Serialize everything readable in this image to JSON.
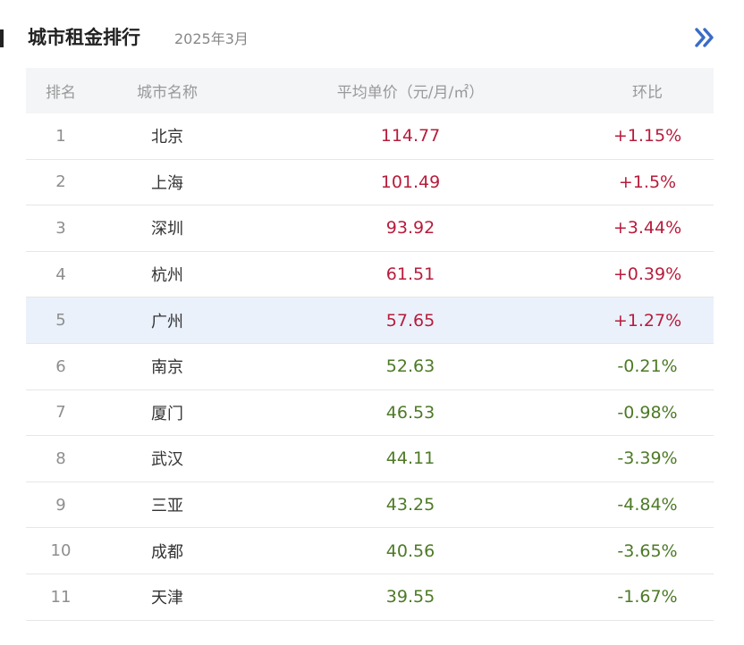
{
  "header": {
    "title": "城市租金排行",
    "date": "2025年3月"
  },
  "table": {
    "columns": [
      "排名",
      "城市名称",
      "平均单价（元/月/㎡）",
      "环比"
    ],
    "rows": [
      {
        "rank": "1",
        "city": "北京",
        "price": "114.77",
        "change": "+1.15%",
        "trend": "up"
      },
      {
        "rank": "2",
        "city": "上海",
        "price": "101.49",
        "change": "+1.5%",
        "trend": "up"
      },
      {
        "rank": "3",
        "city": "深圳",
        "price": "93.92",
        "change": "+3.44%",
        "trend": "up"
      },
      {
        "rank": "4",
        "city": "杭州",
        "price": "61.51",
        "change": "+0.39%",
        "trend": "up"
      },
      {
        "rank": "5",
        "city": "广州",
        "price": "57.65",
        "change": "+1.27%",
        "trend": "up"
      },
      {
        "rank": "6",
        "city": "南京",
        "price": "52.63",
        "change": "-0.21%",
        "trend": "down"
      },
      {
        "rank": "7",
        "city": "厦门",
        "price": "46.53",
        "change": "-0.98%",
        "trend": "down"
      },
      {
        "rank": "8",
        "city": "武汉",
        "price": "44.11",
        "change": "-3.39%",
        "trend": "down"
      },
      {
        "rank": "9",
        "city": "三亚",
        "price": "43.25",
        "change": "-4.84%",
        "trend": "down"
      },
      {
        "rank": "10",
        "city": "成都",
        "price": "40.56",
        "change": "-3.65%",
        "trend": "down"
      },
      {
        "rank": "11",
        "city": "天津",
        "price": "39.55",
        "change": "-1.67%",
        "trend": "down"
      }
    ],
    "highlighted_rank": "5"
  },
  "icons": {
    "more": "double-chevron-right-icon"
  },
  "colors": {
    "up": "#b71c3c",
    "down": "#4d7a26",
    "accent": "#3b6cc4",
    "highlight_row": "#eaf1fb",
    "header_bg": "#f4f5f7"
  }
}
